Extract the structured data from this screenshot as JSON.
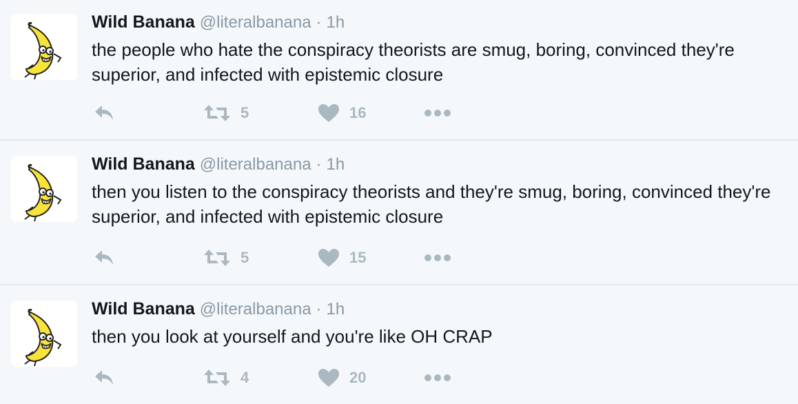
{
  "tweets": [
    {
      "author": {
        "display_name": "Wild Banana",
        "handle": "@literalbanana"
      },
      "separator": "·",
      "time": "1h",
      "text": "the people who hate the conspiracy theorists are smug, boring, convinced they're superior, and infected with epistemic closure",
      "retweets": "5",
      "likes": "16"
    },
    {
      "author": {
        "display_name": "Wild Banana",
        "handle": "@literalbanana"
      },
      "separator": "·",
      "time": "1h",
      "text": "then you listen to the conspiracy theorists and they're smug, boring, convinced they're superior, and infected with epistemic closure",
      "retweets": "5",
      "likes": "15"
    },
    {
      "author": {
        "display_name": "Wild Banana",
        "handle": "@literalbanana"
      },
      "separator": "·",
      "time": "1h",
      "text": "then you look at yourself and you're like OH CRAP",
      "retweets": "4",
      "likes": "20"
    }
  ],
  "icons": {
    "reply": "reply-icon",
    "retweet": "retweet-icon",
    "like": "heart-icon",
    "more": "more-dots-icon"
  },
  "colors": {
    "background": "#f5f8fa",
    "text": "#14171a",
    "muted": "#8899a6",
    "action": "#aab8c2",
    "divider": "#e1e8ed",
    "avatar_banana": "#f7e33a"
  }
}
